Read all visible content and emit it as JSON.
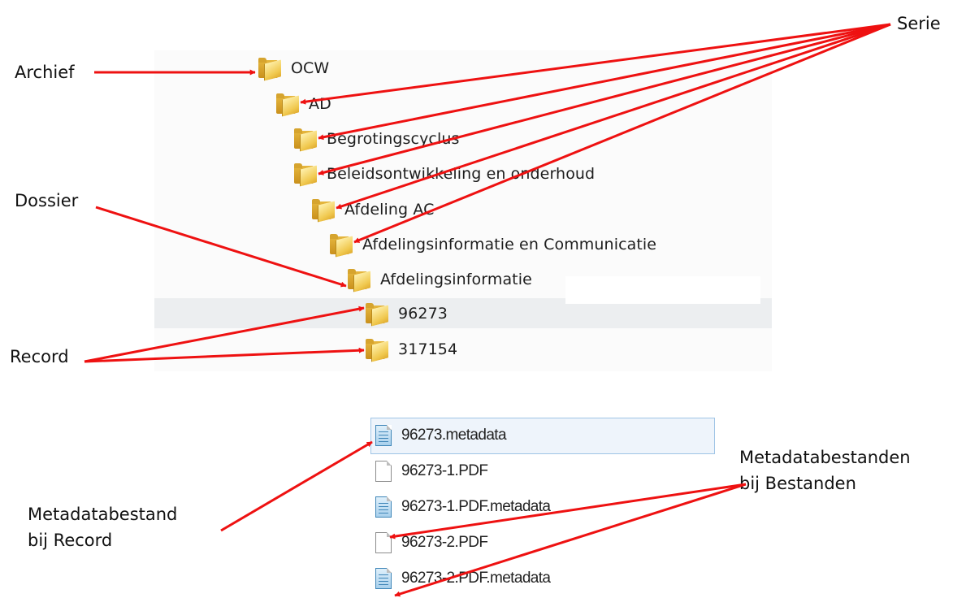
{
  "tree": [
    {
      "label": "OCW"
    },
    {
      "label": "AD"
    },
    {
      "label": "Begrotingscyclus"
    },
    {
      "label": "Beleidsontwikkeling en onderhoud"
    },
    {
      "label": "Afdeling AC"
    },
    {
      "label": "Afdelingsinformatie en Communicatie"
    },
    {
      "label": "Afdelingsinformatie"
    },
    {
      "label": "96273"
    },
    {
      "label": "317154"
    }
  ],
  "files": [
    {
      "label": "96273.metadata",
      "icon": "metadata-file-icon"
    },
    {
      "label": "96273-1.PDF",
      "icon": "pdf-file-icon"
    },
    {
      "label": "96273-1.PDF.metadata",
      "icon": "metadata-file-icon"
    },
    {
      "label": "96273-2.PDF",
      "icon": "pdf-file-icon"
    },
    {
      "label": "96273-2.PDF.metadata",
      "icon": "metadata-file-icon"
    }
  ],
  "callouts": {
    "archief": "Archief",
    "serie": "Serie",
    "dossier": "Dossier",
    "record": "Record",
    "metadata_record_line1": "Metadatabestand",
    "metadata_record_line2": "bij Record",
    "metadata_files_line1": "Metadatabestanden",
    "metadata_files_line2": "bij Bestanden"
  },
  "colors": {
    "arrow": "#ee1111",
    "folder": "#e9bb3f",
    "selection": "#eceef0"
  }
}
